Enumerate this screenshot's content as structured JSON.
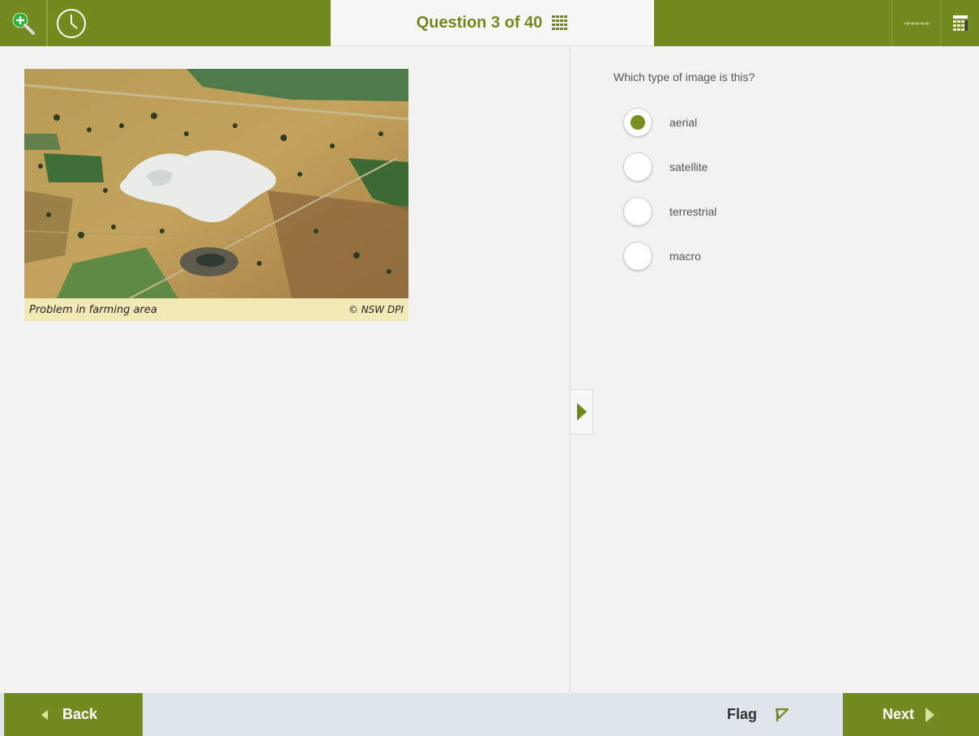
{
  "header": {
    "title": "Question 3 of 40",
    "icons": [
      "zoom-in-icon",
      "clock-icon",
      "grid-icon",
      "line-reader-icon",
      "calculator-icon"
    ]
  },
  "stimulus": {
    "caption": "Problem in farming area",
    "credit": "© NSW DPI"
  },
  "question": {
    "prompt": "Which type of image is this?",
    "options": [
      {
        "label": "aerial",
        "selected": true
      },
      {
        "label": "satellite",
        "selected": false
      },
      {
        "label": "terrestrial",
        "selected": false
      },
      {
        "label": "macro",
        "selected": false
      }
    ]
  },
  "footer": {
    "back_label": "Back",
    "flag_label": "Flag",
    "next_label": "Next"
  },
  "colors": {
    "brand": "#738a1e",
    "accent": "#6f8a1a",
    "caption_bg": "#f1e9b6",
    "footer_bg": "#dee5ec"
  }
}
